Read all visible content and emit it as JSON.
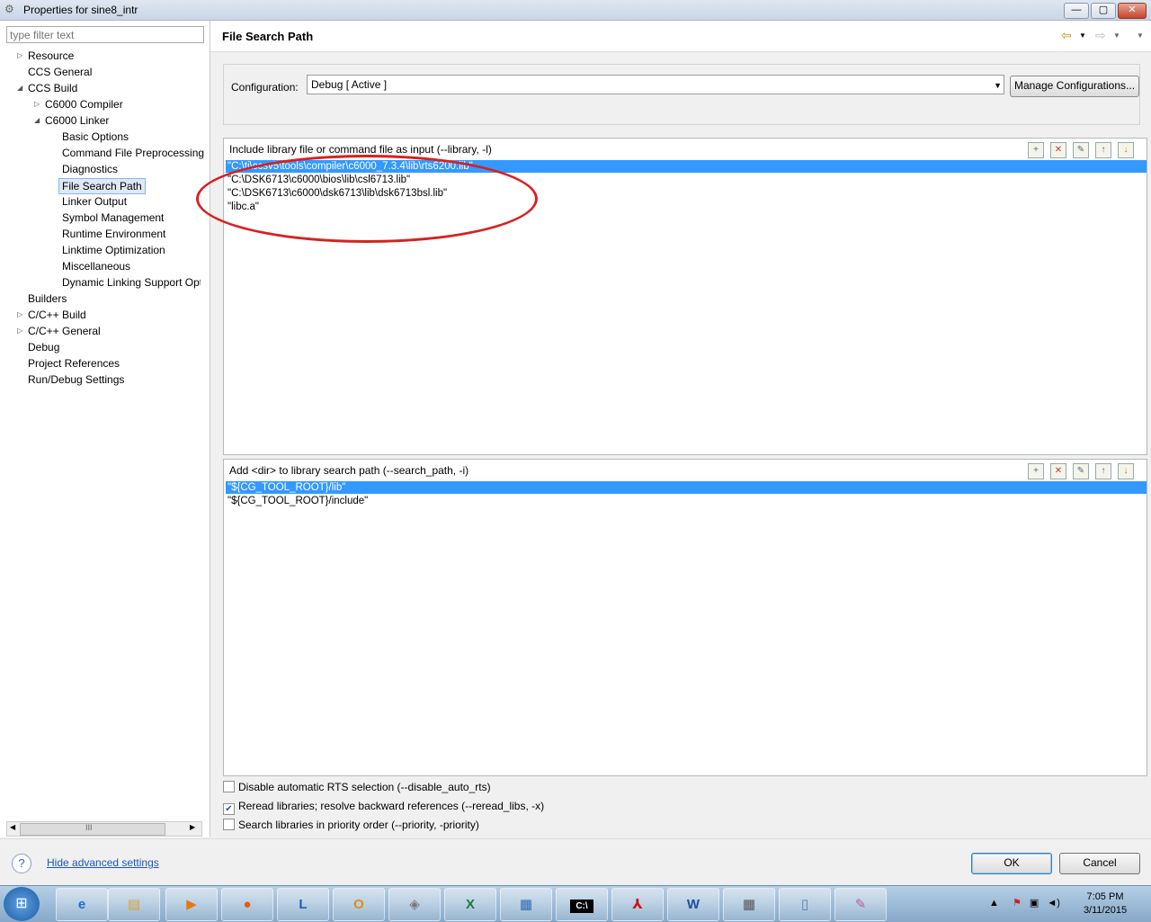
{
  "window": {
    "title": "Properties for sine8_intr",
    "minimize": "—",
    "maximize": "▢",
    "close": "✕"
  },
  "filter": {
    "placeholder": "type filter text"
  },
  "tree": [
    {
      "label": "Resource"
    },
    {
      "label": "CCS General"
    },
    {
      "label": "CCS Build"
    },
    {
      "label": "C6000 Compiler"
    },
    {
      "label": "C6000 Linker"
    },
    {
      "label": "Basic Options"
    },
    {
      "label": "Command File Preprocessing"
    },
    {
      "label": "Diagnostics"
    },
    {
      "label": "File Search Path"
    },
    {
      "label": "Linker Output"
    },
    {
      "label": "Symbol Management"
    },
    {
      "label": "Runtime Environment"
    },
    {
      "label": "Linktime Optimization"
    },
    {
      "label": "Miscellaneous"
    },
    {
      "label": "Dynamic Linking Support Opt"
    },
    {
      "label": "Builders"
    },
    {
      "label": "C/C++ Build"
    },
    {
      "label": "C/C++ General"
    },
    {
      "label": "Debug"
    },
    {
      "label": "Project References"
    },
    {
      "label": "Run/Debug Settings"
    }
  ],
  "scroll_thumb": "III",
  "page": {
    "title": "File Search Path"
  },
  "config": {
    "label": "Configuration:",
    "value": "Debug  [ Active ]",
    "manage_button": "Manage Configurations..."
  },
  "library_panel": {
    "header": "Include library file or command file as input (--library, -l)",
    "items": [
      "\"C:\\ti\\ccsv5\\tools\\compiler\\c6000_7.3.4\\lib\\rts6200.lib\"",
      "\"C:\\DSK6713\\c6000\\bios\\lib\\csl6713.lib\"",
      "\"C:\\DSK6713\\c6000\\dsk6713\\lib\\dsk6713bsl.lib\"",
      "\"libc.a\""
    ]
  },
  "search_panel": {
    "header": "Add <dir> to library search path (--search_path, -i)",
    "items": [
      "\"${CG_TOOL_ROOT}/lib\"",
      "\"${CG_TOOL_ROOT}/include\""
    ]
  },
  "options": [
    {
      "label": "Disable automatic RTS selection (--disable_auto_rts)",
      "checked": false
    },
    {
      "label": "Reread libraries; resolve backward references (--reread_libs, -x)",
      "checked": true
    },
    {
      "label": "Search libraries in priority order (--priority, -priority)",
      "checked": false
    }
  ],
  "footer": {
    "help_link": "Hide advanced settings",
    "ok": "OK",
    "cancel": "Cancel"
  },
  "taskbar": {
    "clock_time": "7:05 PM",
    "clock_date": "3/11/2015",
    "apps": [
      "internet-explorer",
      "file-explorer",
      "media-player",
      "firefox",
      "lync",
      "outlook",
      "virtualbox",
      "excel",
      "control-panel",
      "command-prompt",
      "adobe-reader",
      "word",
      "calculator",
      "notepad",
      "paint"
    ]
  },
  "colors": {
    "selection": "#3399ff",
    "annotation": "#d92020",
    "link": "#1a56c4"
  }
}
